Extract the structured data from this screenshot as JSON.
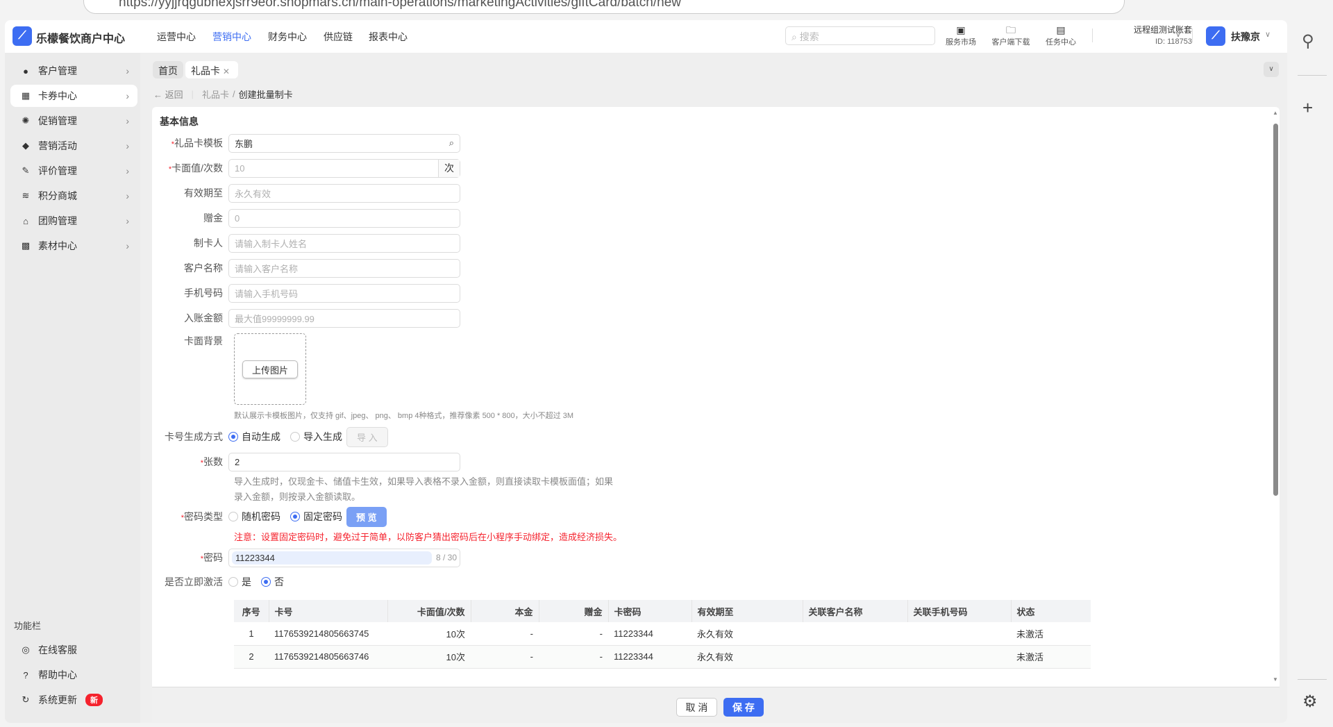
{
  "browser": {
    "url": "https://yyjjrqgubnexjsrr9eor.shopmars.cn/main-operations/marketingActivities/giftCard/batch/new"
  },
  "header": {
    "app_title": "乐檬餐饮商户中心",
    "nav": [
      "运营中心",
      "营销中心",
      "财务中心",
      "供应链",
      "报表中心"
    ],
    "search_placeholder": "搜索",
    "tools": [
      "服务市场",
      "客户端下载",
      "任务中心"
    ],
    "account": "远程组测试账套",
    "account_id": "ID: 118753",
    "user": "扶豫京"
  },
  "sidebar": {
    "items": [
      "客户管理",
      "卡券中心",
      "促销管理",
      "营销活动",
      "评价管理",
      "积分商城",
      "团购管理",
      "素材中心"
    ],
    "section": "功能栏",
    "footer_items": [
      "在线客服",
      "帮助中心",
      "系统更新"
    ],
    "new_badge": "新"
  },
  "tabs": [
    "首页",
    "礼品卡"
  ],
  "breadcrumb": {
    "back": "返回",
    "parent": "礼品卡",
    "current": "创建批量制卡"
  },
  "form": {
    "section_title": "基本信息",
    "template": {
      "label": "礼品卡模板",
      "value": "东鹏"
    },
    "face_value": {
      "label": "卡面值/次数",
      "placeholder": "10",
      "unit": "次"
    },
    "expiry": {
      "label": "有效期至",
      "placeholder": "永久有效"
    },
    "bonus": {
      "label": "赠金",
      "placeholder": "0"
    },
    "maker": {
      "label": "制卡人",
      "placeholder": "请输入制卡人姓名"
    },
    "customer": {
      "label": "客户名称",
      "placeholder": "请输入客户名称"
    },
    "phone": {
      "label": "手机号码",
      "placeholder": "请输入手机号码"
    },
    "amount": {
      "label": "入账金额",
      "placeholder": "最大值99999999.99"
    },
    "background": {
      "label": "卡面背景",
      "upload": "上传图片",
      "hint": "默认展示卡模板图片，仅支持 gif、jpeg、 png、 bmp 4种格式，推荐像素 500 * 800，大小不超过 3M"
    },
    "gen_method": {
      "label": "卡号生成方式",
      "options": [
        "自动生成",
        "导入生成"
      ],
      "import_btn": "导 入"
    },
    "count": {
      "label": "张数",
      "value": "2",
      "hint1": "导入生成时，仅现金卡、储值卡生效，如果导入表格不录入金额，则直接读取卡模板面值；如果",
      "hint2": "录入金额，则按录入金额读取。"
    },
    "pwd_type": {
      "label": "密码类型",
      "options": [
        "随机密码",
        "固定密码"
      ],
      "preview": "预 览",
      "warning": "注意：设置固定密码时，避免过于简单，以防客户猜出密码后在小程序手动绑定，造成经济损失。"
    },
    "password": {
      "label": "密码",
      "value": "11223344",
      "counter": "8 / 30"
    },
    "activate": {
      "label": "是否立即激活",
      "options": [
        "是",
        "否"
      ]
    }
  },
  "table": {
    "headers": [
      "序号",
      "卡号",
      "卡面值/次数",
      "本金",
      "赠金",
      "卡密码",
      "有效期至",
      "关联客户名称",
      "关联手机号码",
      "状态"
    ],
    "rows": [
      [
        "1",
        "1176539214805663745",
        "10次",
        "-",
        "-",
        "11223344",
        "永久有效",
        "",
        "",
        "未激活"
      ],
      [
        "2",
        "1176539214805663746",
        "10次",
        "-",
        "-",
        "11223344",
        "永久有效",
        "",
        "",
        "未激活"
      ]
    ]
  },
  "footer": {
    "cancel": "取 消",
    "save": "保 存"
  },
  "colors": {
    "accent": "#3d6df2",
    "danger": "#f5222d"
  }
}
